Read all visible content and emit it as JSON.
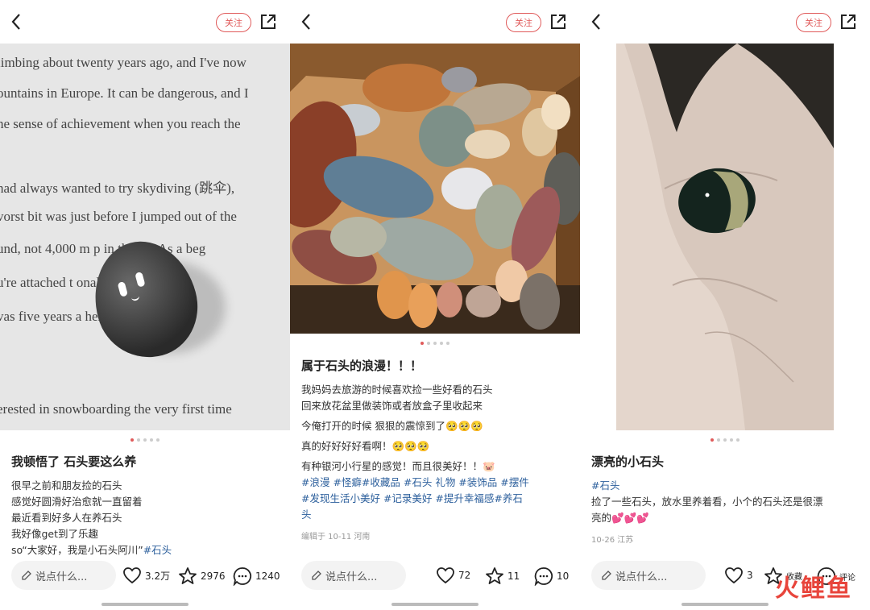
{
  "panels": [
    {
      "follow_label": "关注",
      "image": {
        "text_lines": [
          "limbing about twenty years ago, and I've now",
          "ountains in Europe. It can be dangerous, and I",
          "he sense of achievement when you reach the",
          "had always wanted to try skydiving (跳伞),",
          "vorst bit was just before I jumped out of the",
          "und, not 4,000 m    p in the air. As a beg",
          "u're attached t           onal instructor w",
          "vas five years a          hen I've done",
          "erested in snowboarding the very first time"
        ]
      },
      "title": "我顿悟了 石头要这么养",
      "body": [
        "很早之前和朋友捡的石头",
        "感觉好圆滑好治愈就一直留着",
        "最近看到好多人在养石头",
        "我好像get到了乐趣"
      ],
      "body_last": "so“大家好，我是小石头阿川”",
      "body_last_tag": "#石头",
      "meta": "",
      "input_placeholder": "说点什么...",
      "likes": "3.2万",
      "stars": "2976",
      "comments": "1240"
    },
    {
      "follow_label": "关注",
      "title": "属于石头的浪漫！！！",
      "body": [
        "我妈妈去旅游的时候喜欢捡一些好看的石头",
        "回来放花盆里做装饰或者放盒子里收起来",
        "今俺打开的时候 狠狠的震惊到了🥺🥺🥺",
        "真的好好好好看啊！🥺🥺🥺",
        "有种银河小行星的感觉！而且很美好！！🐷"
      ],
      "tags_line1": "#浪漫 #怪癖#收藏品 #石头 礼物 #装饰品 #摆件",
      "tags_line2": "#发现生活小美好 #记录美好 #提升幸福感#养石",
      "tags_line3": "头",
      "meta": "编辑于 10-11 河南",
      "input_placeholder": "说点什么...",
      "likes": "72",
      "stars": "11",
      "comments": "10"
    },
    {
      "follow_label": "关注",
      "title": "漂亮的小石头",
      "tag": "#石头",
      "body": [
        "捡了一些石头，放水里养着看，小个的石头还是很漂",
        "亮的💕💕💕"
      ],
      "meta": "10-26 江苏",
      "input_placeholder": "说点什么...",
      "likes": "3",
      "stars": "收藏",
      "comments": "评论"
    }
  ],
  "watermark": "火鲤鱼",
  "colors": {
    "accent": "#e05a5a",
    "tag": "#2c5f9c"
  }
}
